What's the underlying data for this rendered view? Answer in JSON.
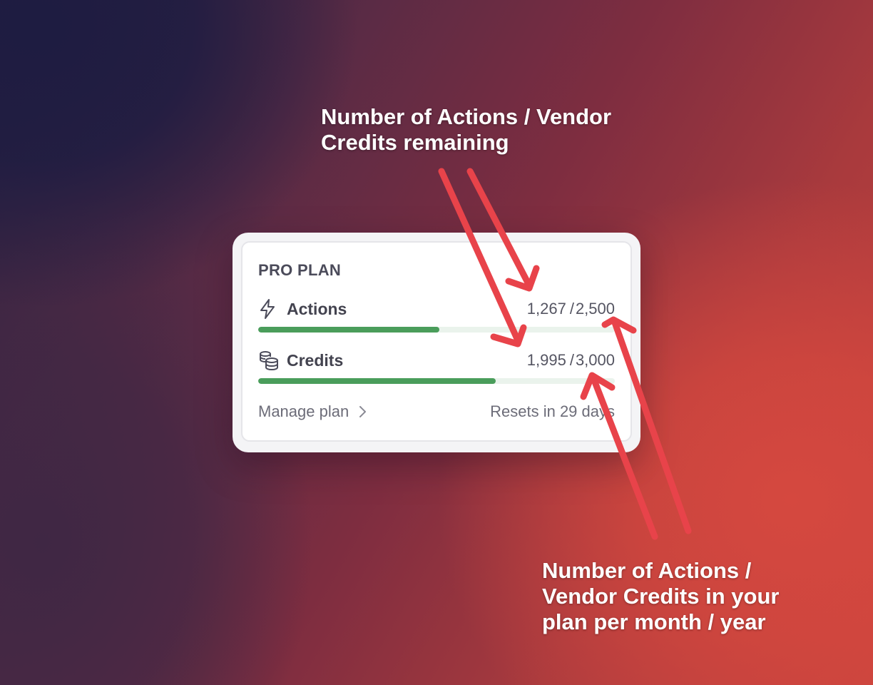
{
  "annotations": {
    "top": "Number of Actions / Vendor Credits remaining",
    "bottom": "Number of Actions / Vendor Credits in your plan per month / year"
  },
  "plan_card": {
    "title": "PRO PLAN",
    "actions": {
      "label": "Actions",
      "icon": "lightning-bolt-icon",
      "used": "1,267",
      "separator": "/",
      "total": "2,500",
      "progress_fraction": 0.507
    },
    "credits": {
      "label": "Credits",
      "icon": "coins-stack-icon",
      "used": "1,995",
      "separator": "/",
      "total": "3,000",
      "progress_fraction": 0.665
    },
    "footer": {
      "manage_label": "Manage plan",
      "resets_label": "Resets in 29 days"
    }
  },
  "colors": {
    "progress_fill": "#4a9d5b",
    "progress_track": "#eaf3ec",
    "arrow": "#e8434a"
  }
}
